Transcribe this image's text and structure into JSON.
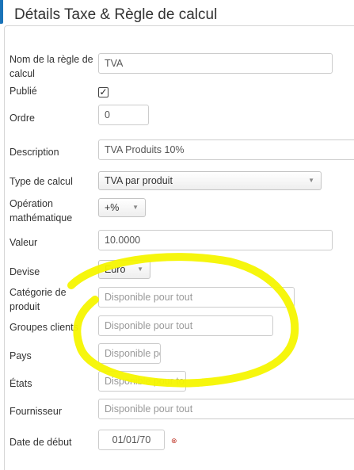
{
  "form": {
    "legend": "Détails Taxe & Règle de calcul",
    "rule_name": {
      "label": "Nom de la règle de calcul",
      "value": "TVA"
    },
    "published": {
      "label": "Publié",
      "checked": true
    },
    "order": {
      "label": "Ordre",
      "value": "0"
    },
    "description": {
      "label": "Description",
      "value": "TVA Produits 10%"
    },
    "calc_type": {
      "label": "Type de calcul",
      "value": "TVA par produit"
    },
    "math_op": {
      "label": "Opération mathématique",
      "value": "+%"
    },
    "value": {
      "label": "Valeur",
      "value": "10.0000"
    },
    "currency": {
      "label": "Devise",
      "value": "Euro"
    },
    "category": {
      "label": "Catégorie de produit",
      "placeholder": "Disponible pour tout"
    },
    "client_groups": {
      "label": "Groupes clients",
      "placeholder": "Disponible pour tout"
    },
    "country": {
      "label": "Pays",
      "placeholder": "Disponible pour tout"
    },
    "states": {
      "label": "États",
      "placeholder": "Disponible pour tout"
    },
    "supplier": {
      "label": "Fournisseur",
      "placeholder": "Disponible pour tout"
    },
    "start_date": {
      "label": "Date de début",
      "value": "01/01/70"
    }
  },
  "colors": {
    "accent": "#1a73b8",
    "highlight": "#f5f500"
  },
  "icons": {
    "checkbox": "checkmark-icon",
    "select_arrow": "chevron-down-icon",
    "date_reset": "calendar-clear-icon"
  }
}
